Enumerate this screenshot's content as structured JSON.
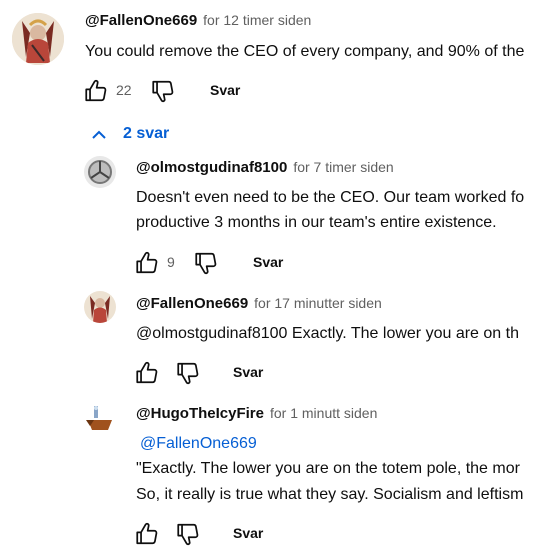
{
  "comment": {
    "author": "@FallenOne669",
    "time": "for 12 timer siden",
    "text": "You could remove the CEO of every company, and 90% of the",
    "likes": "22",
    "reply_label": "Svar"
  },
  "replies_toggle": "2 svar",
  "replies": [
    {
      "author": "@olmostgudinaf8100",
      "time": "for 7 timer siden",
      "line1": "Doesn't even need to be the CEO. Our team worked fo",
      "line2": "productive 3 months in our team's entire existence.",
      "likes": "9",
      "reply_label": "Svar"
    },
    {
      "author": "@FallenOne669",
      "time": "for 17 minutter siden",
      "line1": "@olmostgudinaf8100  Exactly. The lower you are on th",
      "reply_label": "Svar"
    },
    {
      "author": "@HugoTheIcyFire",
      "time": "for 1 minutt siden",
      "mention": "@FallenOne669",
      "line1": "\"Exactly. The lower you are on the totem pole, the mor",
      "line2": "So, it really is true what they say. Socialism and leftism",
      "reply_label": "Svar"
    }
  ]
}
